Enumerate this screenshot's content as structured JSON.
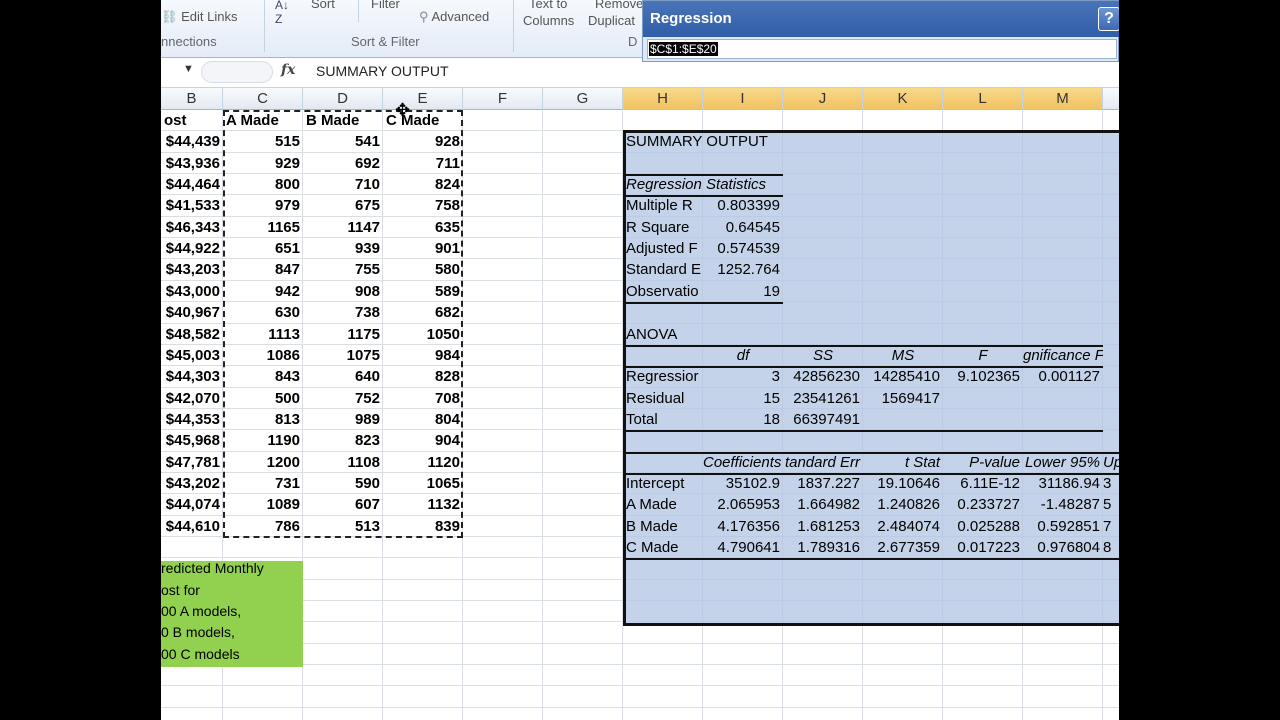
{
  "ribbon": {
    "edit_links": "Edit Links",
    "connections": "nnections",
    "sort": "Sort",
    "filter": "Filter",
    "advanced": "Advanced",
    "sort_filter_group": "Sort & Filter",
    "text_to": "Text to",
    "columns": "Columns",
    "remove": "Remove",
    "duplicates": "Duplicat",
    "data_tools_group": "D"
  },
  "formula_bar": {
    "fx": "fx",
    "content": "SUMMARY OUTPUT"
  },
  "columns": [
    "B",
    "C",
    "D",
    "E",
    "F",
    "G",
    "H",
    "I",
    "J",
    "K",
    "L",
    "M"
  ],
  "data_table": {
    "headers": [
      "ost",
      "A Made",
      "B Made",
      "C Made"
    ],
    "rows": [
      [
        "$44,439",
        "515",
        "541",
        "928"
      ],
      [
        "$43,936",
        "929",
        "692",
        "711"
      ],
      [
        "$44,464",
        "800",
        "710",
        "824"
      ],
      [
        "$41,533",
        "979",
        "675",
        "758"
      ],
      [
        "$46,343",
        "1165",
        "1147",
        "635"
      ],
      [
        "$44,922",
        "651",
        "939",
        "901"
      ],
      [
        "$43,203",
        "847",
        "755",
        "580"
      ],
      [
        "$43,000",
        "942",
        "908",
        "589"
      ],
      [
        "$40,967",
        "630",
        "738",
        "682"
      ],
      [
        "$48,582",
        "1113",
        "1175",
        "1050"
      ],
      [
        "$45,003",
        "1086",
        "1075",
        "984"
      ],
      [
        "$44,303",
        "843",
        "640",
        "828"
      ],
      [
        "$42,070",
        "500",
        "752",
        "708"
      ],
      [
        "$44,353",
        "813",
        "989",
        "804"
      ],
      [
        "$45,968",
        "1190",
        "823",
        "904"
      ],
      [
        "$47,781",
        "1200",
        "1108",
        "1120"
      ],
      [
        "$43,202",
        "731",
        "590",
        "1065"
      ],
      [
        "$44,074",
        "1089",
        "607",
        "1132"
      ],
      [
        "$44,610",
        "786",
        "513",
        "839"
      ]
    ]
  },
  "prediction_note": [
    "redicted Monthly",
    "ost for",
    "00 A models,",
    "0 B models,",
    "00 C models"
  ],
  "summary": {
    "title": "SUMMARY OUTPUT",
    "reg_stats_header": "Regression Statistics",
    "reg_stats": [
      [
        "Multiple R",
        "0.803399"
      ],
      [
        "R Square",
        "0.64545"
      ],
      [
        "Adjusted F",
        "0.574539"
      ],
      [
        "Standard E",
        "1252.764"
      ],
      [
        "Observatio",
        "19"
      ]
    ],
    "anova_label": "ANOVA",
    "anova_headers": [
      "df",
      "SS",
      "MS",
      "F",
      "gnificance F"
    ],
    "anova_rows": [
      [
        "Regressior",
        "3",
        "42856230",
        "14285410",
        "9.102365",
        "0.001127"
      ],
      [
        "Residual",
        "15",
        "23541261",
        "1569417",
        "",
        ""
      ],
      [
        "Total",
        "18",
        "66397491",
        "",
        "",
        ""
      ]
    ],
    "coef_headers": [
      "Coefficients",
      "tandard Err",
      "t Stat",
      "P-value",
      "Lower 95%",
      "Up"
    ],
    "coef_rows": [
      [
        "Intercept",
        "35102.9",
        "1837.227",
        "19.10646",
        "6.11E-12",
        "31186.94",
        "3"
      ],
      [
        "A Made",
        "2.065953",
        "1.664982",
        "1.240826",
        "0.233727",
        "-1.48287",
        "5"
      ],
      [
        "B Made",
        "4.176356",
        "1.681253",
        "2.484074",
        "0.025288",
        "0.592851",
        "7"
      ],
      [
        "C Made",
        "4.790641",
        "1.789316",
        "2.677359",
        "0.017223",
        "0.976804",
        "8"
      ]
    ]
  },
  "dialog": {
    "title": "Regression",
    "help": "?",
    "input_value": "$C$1:$E$20"
  }
}
